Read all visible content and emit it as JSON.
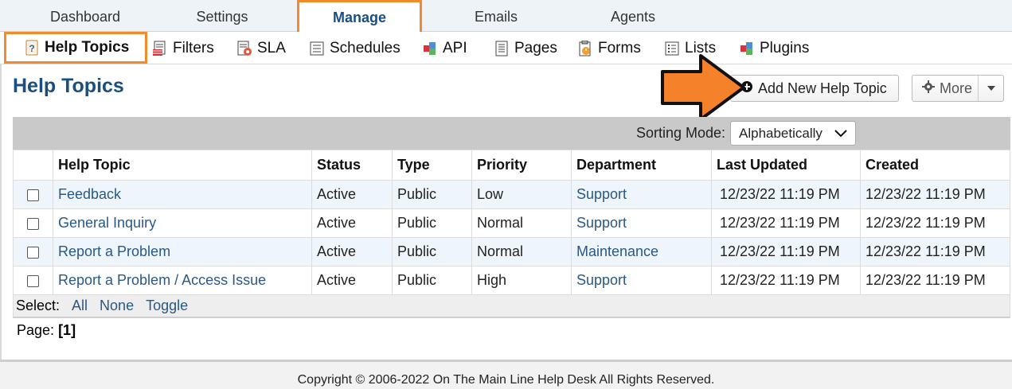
{
  "top_tabs": [
    {
      "label": "Dashboard"
    },
    {
      "label": "Settings"
    },
    {
      "label": "Manage"
    },
    {
      "label": "Emails"
    },
    {
      "label": "Agents"
    }
  ],
  "sub_nav": [
    {
      "label": "Help Topics",
      "icon": "help-topics-icon"
    },
    {
      "label": "Filters",
      "icon": "filters-icon"
    },
    {
      "label": "SLA",
      "icon": "sla-icon"
    },
    {
      "label": "Schedules",
      "icon": "schedules-icon"
    },
    {
      "label": "API",
      "icon": "api-icon"
    },
    {
      "label": "Pages",
      "icon": "pages-icon"
    },
    {
      "label": "Forms",
      "icon": "forms-icon"
    },
    {
      "label": "Lists",
      "icon": "lists-icon"
    },
    {
      "label": "Plugins",
      "icon": "plugins-icon"
    }
  ],
  "page": {
    "title": "Help Topics",
    "add_button": "Add New Help Topic",
    "more_button": "More"
  },
  "sorting": {
    "label": "Sorting Mode:",
    "value": "Alphabetically"
  },
  "table": {
    "columns": [
      "Help Topic",
      "Status",
      "Type",
      "Priority",
      "Department",
      "Last Updated",
      "Created"
    ],
    "rows": [
      {
        "topic": "Feedback",
        "status": "Active",
        "type": "Public",
        "priority": "Low",
        "department": "Support",
        "updated": "12/23/22 11:19 PM",
        "created": "12/23/22 11:19 PM"
      },
      {
        "topic": "General Inquiry",
        "status": "Active",
        "type": "Public",
        "priority": "Normal",
        "department": "Support",
        "updated": "12/23/22 11:19 PM",
        "created": "12/23/22 11:19 PM"
      },
      {
        "topic": "Report a Problem",
        "status": "Active",
        "type": "Public",
        "priority": "Normal",
        "department": "Maintenance",
        "updated": "12/23/22 11:19 PM",
        "created": "12/23/22 11:19 PM"
      },
      {
        "topic": "Report a Problem / Access Issue",
        "status": "Active",
        "type": "Public",
        "priority": "High",
        "department": "Support",
        "updated": "12/23/22 11:19 PM",
        "created": "12/23/22 11:19 PM"
      }
    ]
  },
  "select_bar": {
    "label": "Select:",
    "all": "All",
    "none": "None",
    "toggle": "Toggle"
  },
  "pager": {
    "label": "Page:",
    "current": "[1]"
  },
  "footer": {
    "text": "Copyright © 2006-2022 On The Main Line Help Desk All Rights Reserved."
  },
  "colors": {
    "accent": "#f58a2c",
    "title": "#184e81",
    "link": "#2a5885"
  }
}
